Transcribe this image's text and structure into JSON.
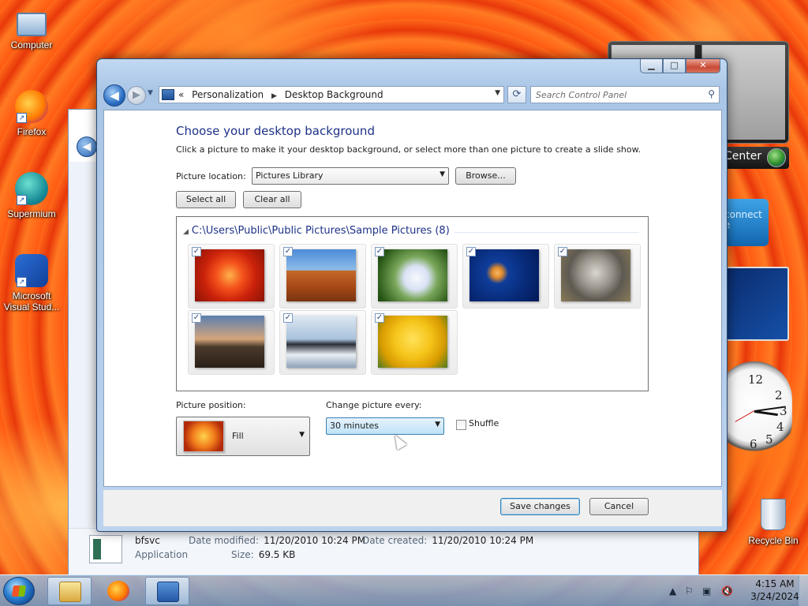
{
  "desktop": {
    "icons": [
      {
        "label": "Computer"
      },
      {
        "label": "Firefox"
      },
      {
        "label": "Supermium"
      },
      {
        "label": "Microsoft Visual Stud..."
      }
    ],
    "recycle_bin": "Recycle Bin"
  },
  "gadgets": {
    "media_center": "Center",
    "connect": "connect\ne"
  },
  "clock_gadget": {
    "numbers": [
      "12",
      "2",
      "3",
      "4",
      "5",
      "6"
    ]
  },
  "background_window": {
    "file_name": "bfsvc",
    "file_type": "Application",
    "date_modified_label": "Date modified:",
    "date_modified": "11/20/2010 10:24 PM",
    "date_created_label": "Date created:",
    "date_created": "11/20/2010 10:24 PM",
    "size_label": "Size:",
    "size": "69.5 KB"
  },
  "window": {
    "breadcrumbs": [
      "Personalization",
      "Desktop Background"
    ],
    "search_placeholder": "Search Control Panel",
    "heading": "Choose your desktop background",
    "intro": "Click a picture to make it your desktop background, or select more than one picture to create a slide show.",
    "picture_location_label": "Picture location:",
    "picture_location_value": "Pictures Library",
    "browse_label": "Browse...",
    "select_all_label": "Select all",
    "clear_all_label": "Clear all",
    "folder_path": "C:\\Users\\Public\\Public Pictures\\Sample Pictures (8)",
    "pictures": [
      {
        "name": "Chrysanthemum",
        "checked": true
      },
      {
        "name": "Desert",
        "checked": true
      },
      {
        "name": "Hydrangeas",
        "checked": true
      },
      {
        "name": "Jellyfish",
        "checked": true
      },
      {
        "name": "Koala",
        "checked": true
      },
      {
        "name": "Lighthouse",
        "checked": true
      },
      {
        "name": "Penguins",
        "checked": true
      },
      {
        "name": "Tulips",
        "checked": true
      }
    ],
    "picture_position_label": "Picture position:",
    "picture_position_value": "Fill",
    "change_picture_label": "Change picture every:",
    "change_picture_value": "30 minutes",
    "shuffle_label": "Shuffle",
    "shuffle_checked": false,
    "save_label": "Save changes",
    "cancel_label": "Cancel"
  },
  "taskbar": {
    "time": "4:15 AM",
    "date": "3/24/2024"
  },
  "colors": {
    "heading": "#1e3287",
    "accent_button_border": "#3c7fb1",
    "close_button": "#c84a35"
  }
}
